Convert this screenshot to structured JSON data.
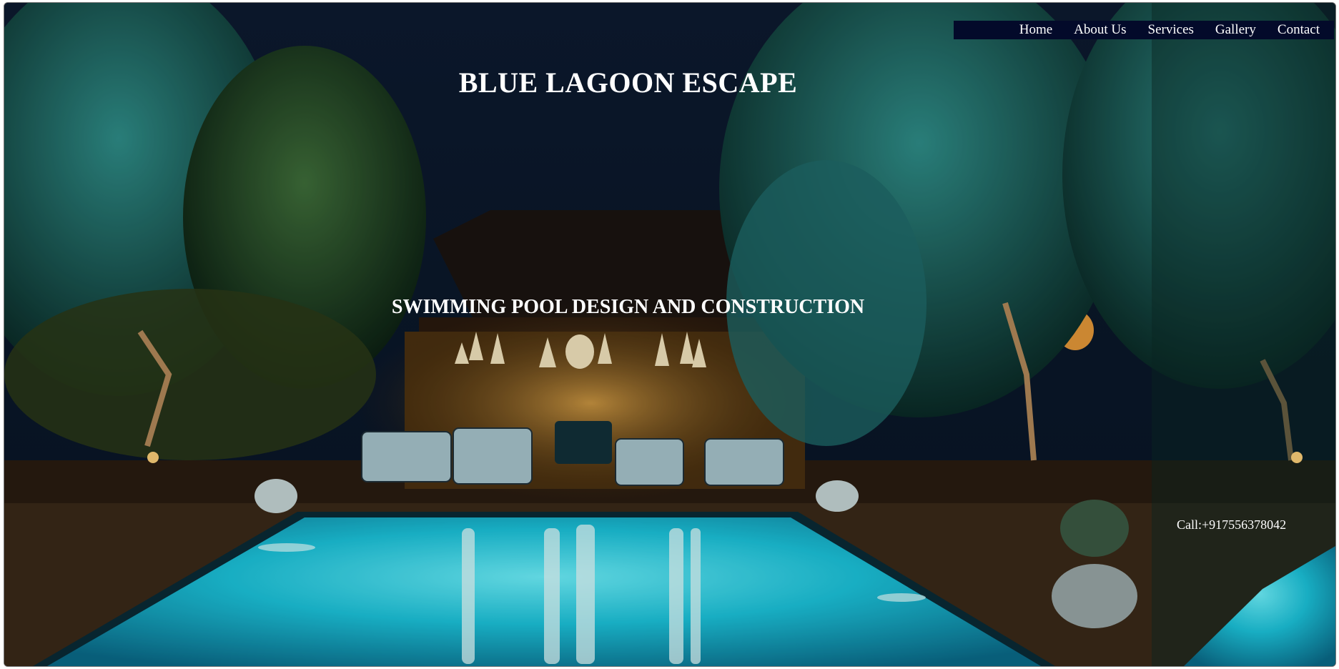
{
  "nav": {
    "items": [
      {
        "label": "Home"
      },
      {
        "label": "About Us"
      },
      {
        "label": "Services"
      },
      {
        "label": "Gallery"
      },
      {
        "label": "Contact"
      }
    ]
  },
  "hero": {
    "title": "BLUE LAGOON ESCAPE",
    "subtitle": "SWIMMING POOL DESIGN AND CONSTRUCTION",
    "background_image": "night-pool-resort-photo",
    "call_text": "Call:+917556378042"
  },
  "colors": {
    "nav_background": "#030a2a",
    "text": "#ffffff",
    "pool": "#22d0e8",
    "sky": "#0b1a30"
  }
}
